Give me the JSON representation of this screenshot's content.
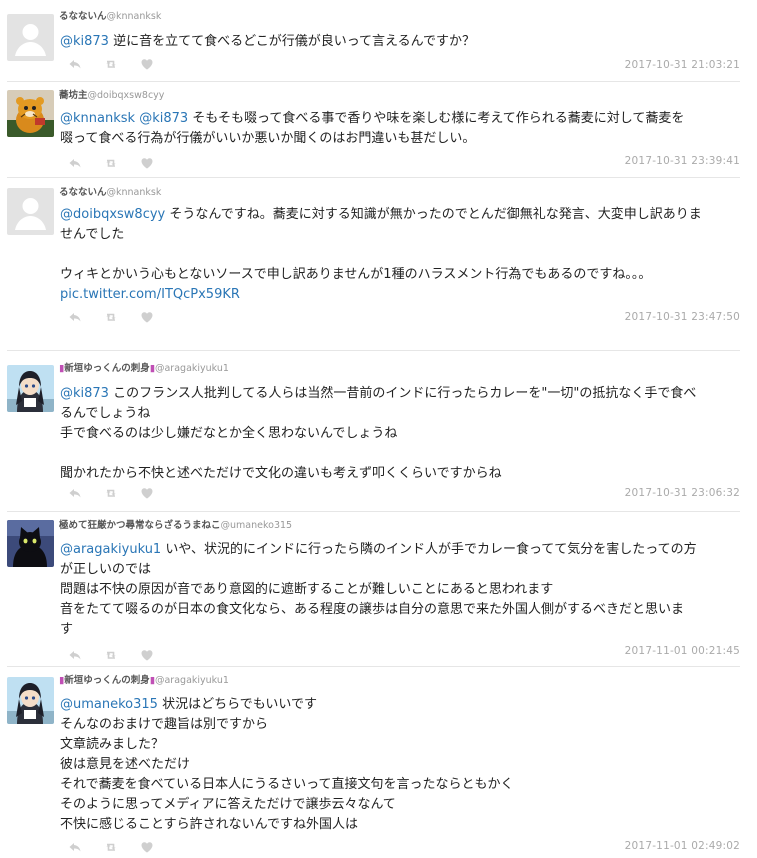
{
  "tweets": [
    {
      "display_name": "るなないん",
      "screen_name": "@knnanksk",
      "avatar": "default-avatar",
      "body": [
        [
          {
            "t": "mention",
            "v": "@ki873"
          },
          {
            "t": "text",
            "v": " 逆に音を立てて食べるどこが行儀が良いって言えるんですか？"
          }
        ]
      ],
      "timestamp": "2017-10-31 21:03:21"
    },
    {
      "display_name": "蕎坊主",
      "screen_name": "@doibqxsw8cyy",
      "avatar": "tiger-plush-avatar",
      "body": [
        [
          {
            "t": "mention",
            "v": "@knnanksk"
          },
          {
            "t": "text",
            "v": " "
          },
          {
            "t": "mention",
            "v": "@ki873"
          },
          {
            "t": "text",
            "v": " そもそも啜って食べる事で香りや味を楽しむ様に考えて作られる蕎麦に対して蕎麦を"
          }
        ],
        [
          {
            "t": "text",
            "v": "啜って食べる行為が行儀がいいか悪いか聞くのはお門違いも甚だしい。"
          }
        ]
      ],
      "timestamp": "2017-10-31 23:39:41"
    },
    {
      "display_name": "るなないん",
      "screen_name": "@knnanksk",
      "avatar": "default-avatar",
      "body": [
        [
          {
            "t": "mention",
            "v": "@doibqxsw8cyy"
          },
          {
            "t": "text",
            "v": " そうなんですね。蕎麦に対する知識が無かったのでとんだ御無礼な発言、大変申し訳ありま"
          }
        ],
        [
          {
            "t": "text",
            "v": "せんでした"
          }
        ],
        [],
        [
          {
            "t": "text",
            "v": "ウィキとかいう心もとないソースで申し訳ありませんが1種のハラスメント行為でもあるのですね。。。"
          }
        ],
        [
          {
            "t": "link",
            "v": "pic.twitter.com/ITQcPx59KR"
          }
        ]
      ],
      "timestamp": "2017-10-31 23:47:50"
    },
    {
      "display_name": "新垣ゆっくんの刺身",
      "screen_name": "@aragakiyuku1",
      "avatar": "anime-girl-avatar",
      "body": [
        [
          {
            "t": "mention",
            "v": "@ki873"
          },
          {
            "t": "text",
            "v": " このフランス人批判してる人らは当然一昔前のインドに行ったらカレーを\"一切\"の抵抗なく手で食べ"
          }
        ],
        [
          {
            "t": "text",
            "v": "るんでしょうね"
          }
        ],
        [
          {
            "t": "text",
            "v": "手で食べるのは少し嫌だなとか全く思わないんでしょうね"
          }
        ],
        [],
        [
          {
            "t": "text",
            "v": "聞かれたから不快と述べただけで文化の違いも考えず叩くくらいですからね"
          }
        ]
      ],
      "timestamp": "2017-10-31 23:06:32"
    },
    {
      "display_name": "極めて狂厳かつ尋常ならざるうまねこ",
      "screen_name": "@umaneko315",
      "avatar": "black-cat-avatar",
      "body": [
        [
          {
            "t": "mention",
            "v": "@aragakiyuku1"
          },
          {
            "t": "text",
            "v": " いや、状況的にインドに行ったら隣のインド人が手でカレー食ってて気分を害したっての方"
          }
        ],
        [
          {
            "t": "text",
            "v": "が正しいのでは"
          }
        ],
        [
          {
            "t": "text",
            "v": "問題は不快の原因が音であり意図的に遮断することが難しいことにあると思われます"
          }
        ],
        [
          {
            "t": "text",
            "v": "音をたてて啜るのが日本の食文化なら、ある程度の譲歩は自分の意思で来た外国人側がするべきだと思いま"
          }
        ],
        [
          {
            "t": "text",
            "v": "す"
          }
        ]
      ],
      "timestamp": "2017-11-01 00:21:45"
    },
    {
      "display_name": "新垣ゆっくんの刺身",
      "screen_name": "@aragakiyuku1",
      "avatar": "anime-girl-avatar",
      "body": [
        [
          {
            "t": "mention",
            "v": "@umaneko315"
          },
          {
            "t": "text",
            "v": " 状況はどちらでもいいです"
          }
        ],
        [
          {
            "t": "text",
            "v": "そんなのおまけで趣旨は別ですから"
          }
        ],
        [
          {
            "t": "text",
            "v": "文章読みました？"
          }
        ],
        [
          {
            "t": "text",
            "v": "彼は意見を述べただけ"
          }
        ],
        [
          {
            "t": "text",
            "v": "それで蕎麦を食べている日本人にうるさいって直接文句を言ったならともかく"
          }
        ],
        [
          {
            "t": "text",
            "v": "そのように思ってメディアに答えただけで譲歩云々なんて"
          }
        ],
        [
          {
            "t": "text",
            "v": "不快に感じることすら許されないんですね外国人は"
          }
        ]
      ],
      "timestamp": "2017-11-01 02:49:02"
    }
  ],
  "action_icons": [
    "reply-icon",
    "retweet-icon",
    "like-icon"
  ],
  "colors": {
    "mention": "#2a76b6",
    "icon": "#cfcfcf",
    "timestamp": "#aaaaaa",
    "display_name": "#555555"
  }
}
